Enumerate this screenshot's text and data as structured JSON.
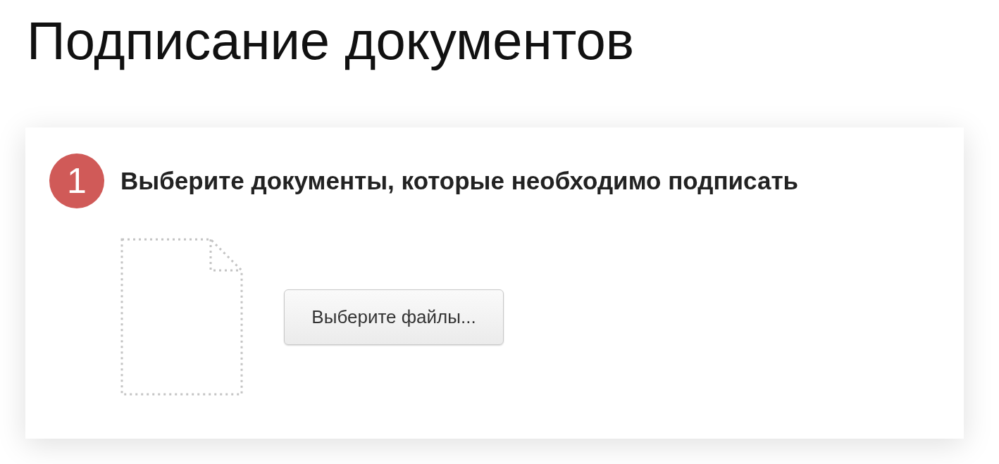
{
  "page": {
    "title": "Подписание документов"
  },
  "steps": [
    {
      "number": "1",
      "heading": "Выберите документы, которые необходимо подписать",
      "button": "Выберите файлы..."
    }
  ]
}
